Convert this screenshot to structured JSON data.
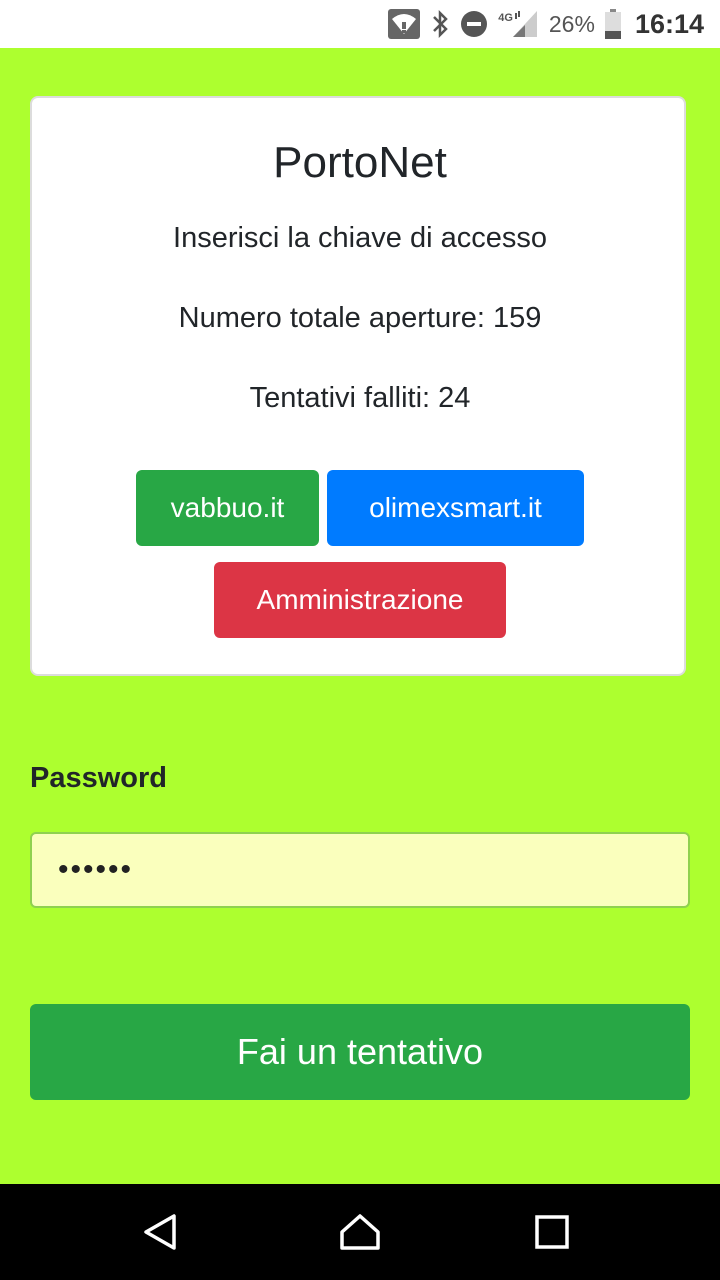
{
  "status_bar": {
    "network": "4G",
    "battery_percent": "26%",
    "time": "16:14",
    "icons": [
      "wifi-icon",
      "bluetooth-icon",
      "do-not-disturb-icon",
      "signal-icon",
      "battery-icon"
    ]
  },
  "card": {
    "title": "PortoNet",
    "subtitle": "Inserisci la chiave di accesso",
    "total_openings": "Numero totale aperture: 159",
    "failed_attempts": "Tentativi falliti: 24",
    "buttons": {
      "vabbuo": "vabbuo.it",
      "olimexsmart": "olimexsmart.it",
      "admin": "Amministrazione"
    }
  },
  "form": {
    "password_label": "Password",
    "password_value": "••••••",
    "submit_label": "Fai un tentativo"
  },
  "colors": {
    "background": "#adff2f",
    "green": "#28a745",
    "blue": "#007bff",
    "red": "#dc3545",
    "input_bg": "#faffbd"
  },
  "nav_bar": {
    "icons": [
      "back-icon",
      "home-icon",
      "recents-icon"
    ]
  }
}
